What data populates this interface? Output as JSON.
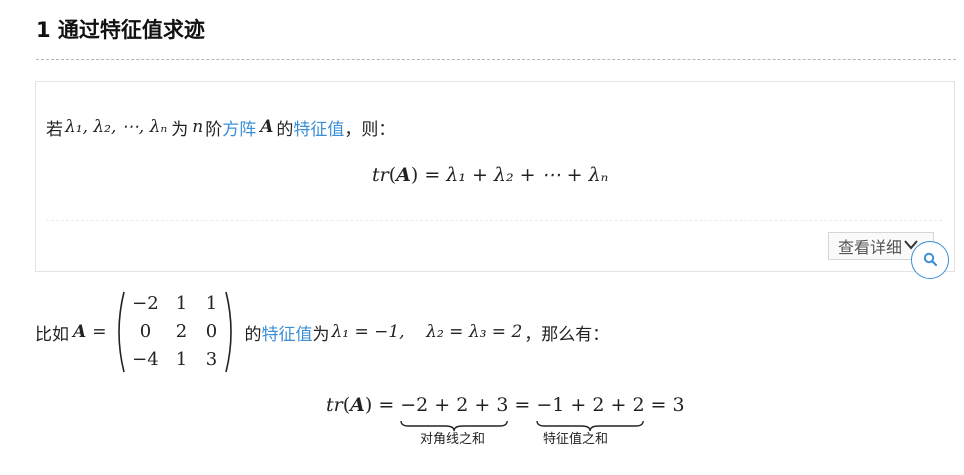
{
  "section": {
    "title": "1 通过特征值求迹"
  },
  "theorem": {
    "prefix": "若",
    "sequence": "λ₁, λ₂, ⋯, λₙ",
    "word_wei": "为",
    "n": "n",
    "jie": "阶",
    "link_square_matrix": "方阵",
    "matrix_symbol": "A",
    "de": "的",
    "link_eigenvalue": "特征值",
    "suffix": "，则："
  },
  "formula_trace": {
    "lhs_tr": "tr",
    "lhs_A": "A",
    "rhs": "= λ₁ + λ₂ + ⋯ + λₙ"
  },
  "detail_button": {
    "label": "查看详细"
  },
  "icons": {
    "chevron": "chevron-down-icon",
    "search": "search-icon"
  },
  "colors": {
    "link": "#3b8fd6",
    "search_border": "#3b8fd6"
  },
  "example": {
    "prefix": "比如",
    "matrix_symbol": "A",
    "equals": "=",
    "matrix_rows": [
      [
        "−2",
        "1",
        "1"
      ],
      [
        "0",
        "2",
        "0"
      ],
      [
        "−4",
        "1",
        "3"
      ]
    ],
    "de": "的",
    "link_eigenvalue": "特征值",
    "wei": "为",
    "values": "λ₁ = −1,    λ₂ = λ₃ = 2",
    "suffix": "，那么有："
  },
  "formula_example": {
    "lhs_tr": "tr",
    "lhs_A": "A",
    "eq1": "=",
    "diag_sum": "−2 + 2 + 3",
    "eq2": "=",
    "eig_sum": "−1 + 2 + 2",
    "result": "= 3",
    "diag_label": "对角线之和",
    "eig_label": "特征值之和"
  }
}
